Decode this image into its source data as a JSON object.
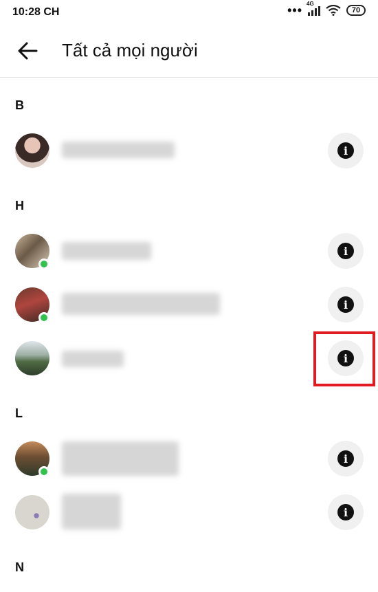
{
  "status_bar": {
    "time": "10:28 CH",
    "dots": "•••",
    "network": "4G",
    "battery": "70"
  },
  "header": {
    "back_icon": "arrow-left-icon",
    "title": "Tất cả mọi người"
  },
  "sections": [
    {
      "letter": "B",
      "contacts": [
        {
          "name": "",
          "online": false
        }
      ]
    },
    {
      "letter": "H",
      "contacts": [
        {
          "name": "",
          "online": true
        },
        {
          "name": "",
          "online": true
        },
        {
          "name": "",
          "online": false,
          "highlighted": true
        }
      ]
    },
    {
      "letter": "L",
      "contacts": [
        {
          "name": "",
          "online": true
        },
        {
          "name": "",
          "online": false
        }
      ]
    },
    {
      "letter": "N",
      "contacts": []
    }
  ],
  "icons": {
    "info": "info-icon",
    "info_glyph": "i"
  },
  "colors": {
    "online": "#31c24d",
    "highlight": "#e01b22",
    "info_button_bg": "#f0f0f0"
  }
}
